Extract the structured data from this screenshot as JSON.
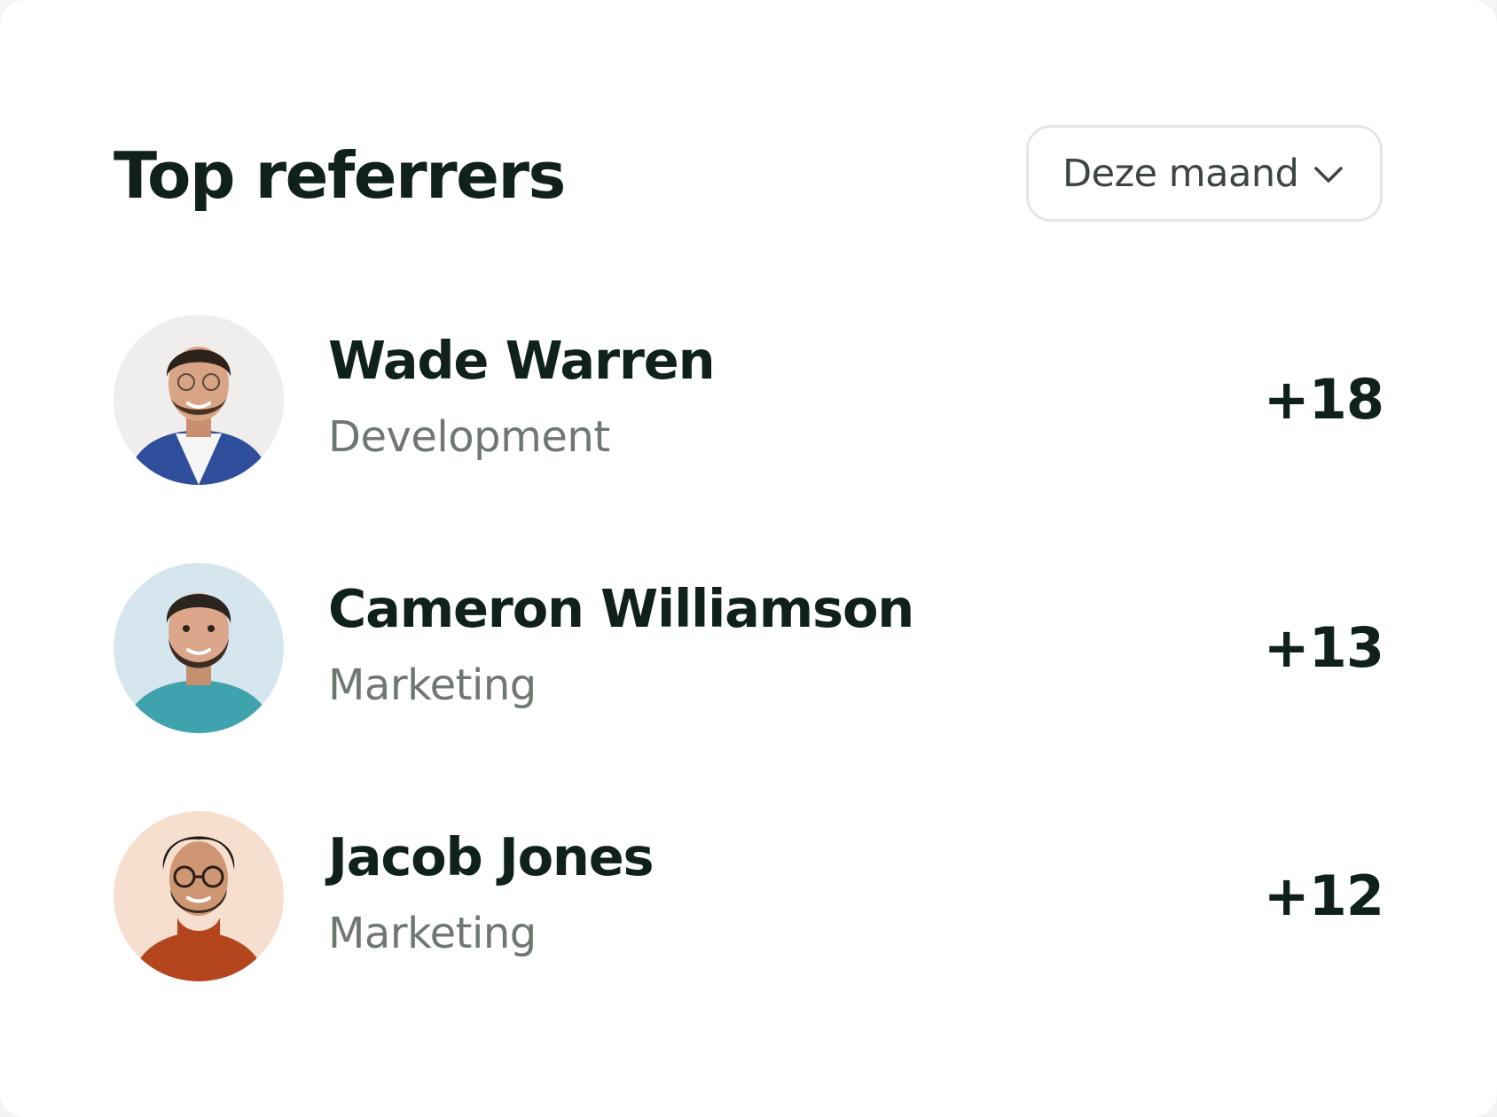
{
  "card": {
    "title": "Top referrers"
  },
  "filter": {
    "selected": "Deze maand",
    "icon": "chevron-down-icon"
  },
  "referrers": [
    {
      "name": "Wade Warren",
      "department": "Development",
      "count": "+18",
      "avatar": {
        "background": "#efeeec",
        "skin": "#d9a485",
        "hair": "#2e211a",
        "shirt": "#f5f5f5",
        "jacket": "#2f4f9c"
      }
    },
    {
      "name": "Cameron Williamson",
      "department": "Marketing",
      "count": "+13",
      "avatar": {
        "background": "#d6e6ef",
        "skin": "#dca68a",
        "hair": "#2b241f",
        "shirt": "#3fa3ad",
        "jacket": "#3fa3ad"
      }
    },
    {
      "name": "Jacob Jones",
      "department": "Marketing",
      "count": "+12",
      "avatar": {
        "background": "#f7dfcf",
        "skin": "#cf9673",
        "hair": "#1e1714",
        "shirt": "#b5451c",
        "jacket": "#b5451c"
      }
    }
  ],
  "colors": {
    "heading": "#0f2118",
    "subtext": "#6f7771",
    "border": "#e4e6e4"
  }
}
